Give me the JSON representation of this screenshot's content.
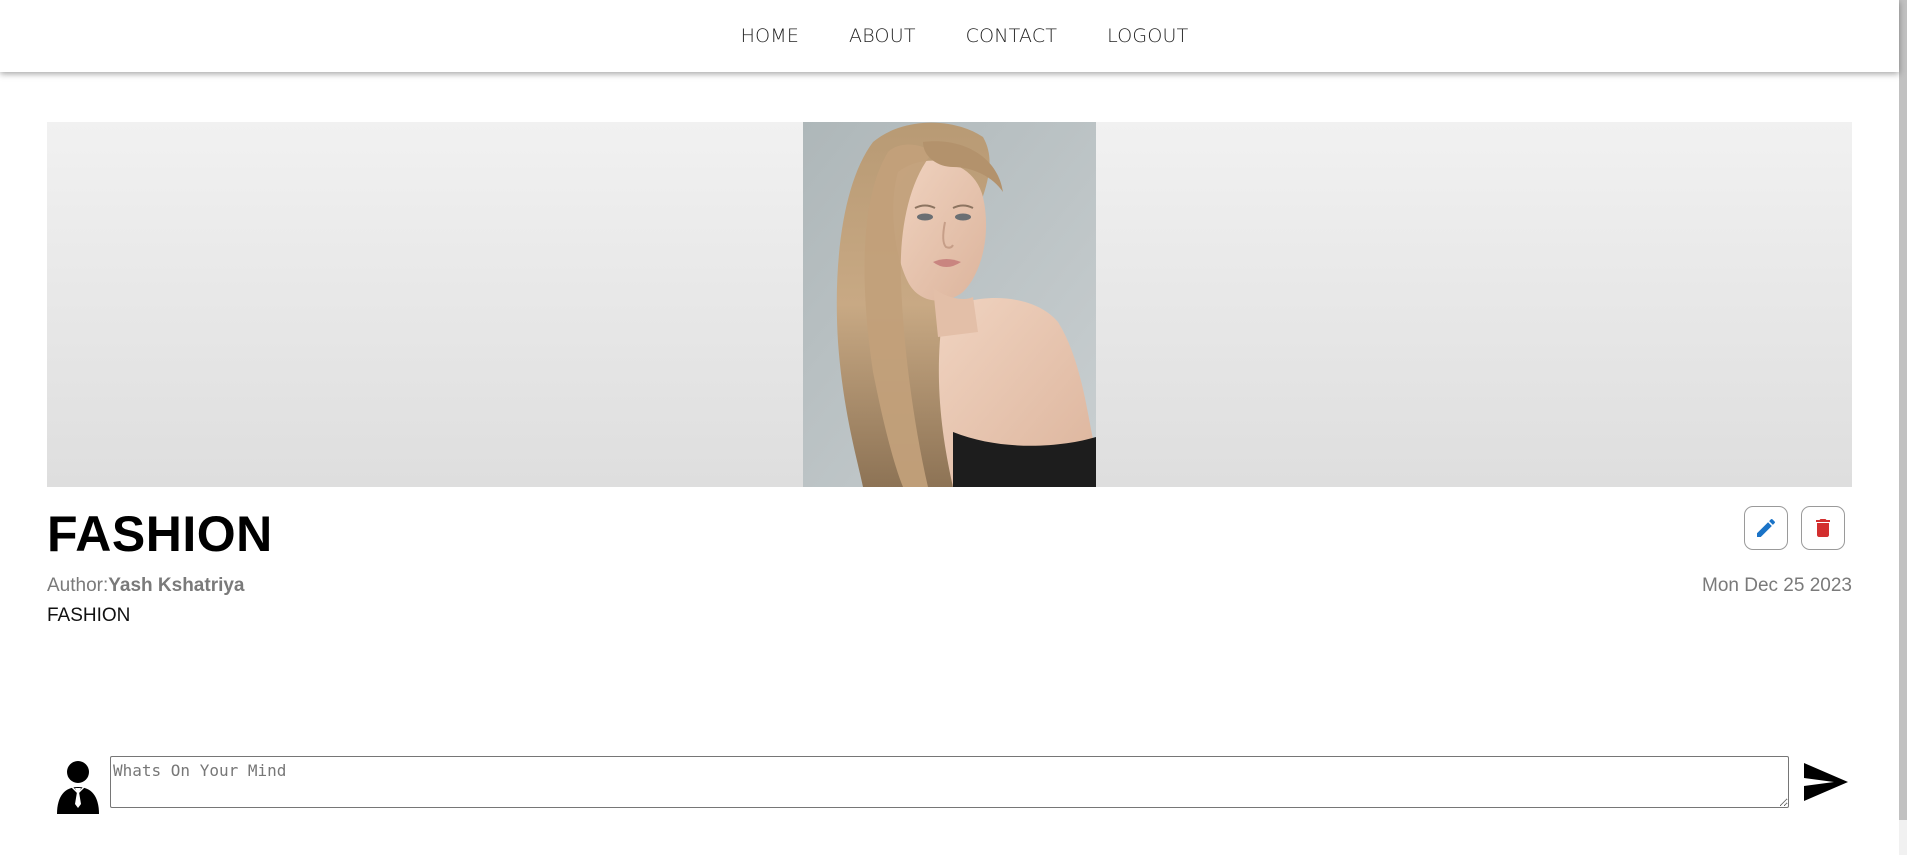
{
  "nav": {
    "items": [
      {
        "label": "HOME"
      },
      {
        "label": "ABOUT"
      },
      {
        "label": "CONTACT"
      },
      {
        "label": "LOGOUT"
      }
    ]
  },
  "post": {
    "title": "FASHION",
    "author_prefix": "Author:",
    "author_name": "Yash Kshatriya",
    "date": "Mon Dec 25 2023",
    "body": "FASHION",
    "image_icon": "portrait-photo"
  },
  "actions": {
    "edit_icon": "pencil-icon",
    "delete_icon": "trash-icon",
    "edit_color": "#1a73c7",
    "delete_color": "#d32f2f"
  },
  "comment": {
    "placeholder": "Whats On Your Mind",
    "value": "",
    "avatar_icon": "user-avatar-icon",
    "send_icon": "send-icon"
  }
}
